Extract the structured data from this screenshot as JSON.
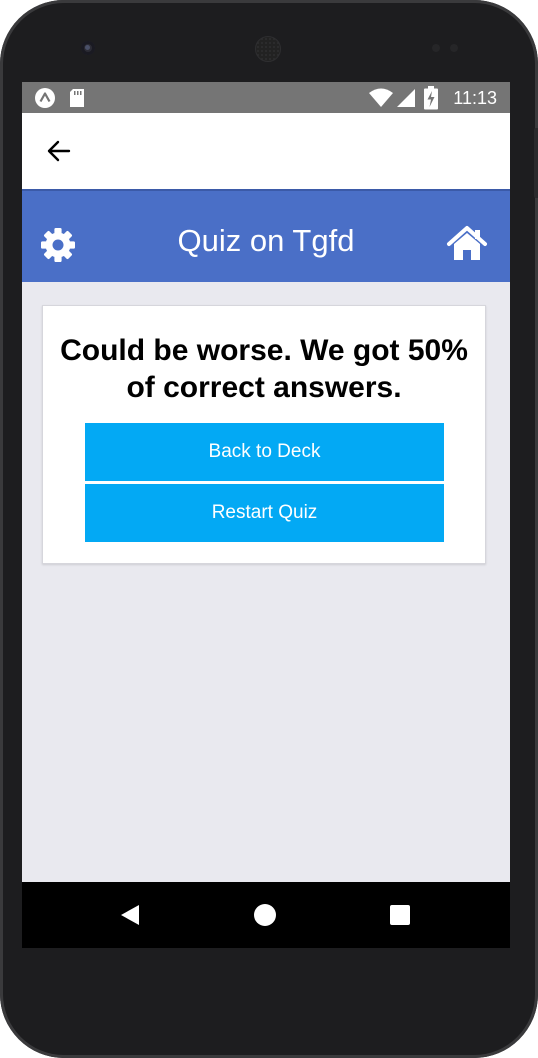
{
  "status_bar": {
    "time": "11:13",
    "left_icons": [
      "expo-icon",
      "sd-card-icon"
    ],
    "right_icons": [
      "wifi-icon",
      "signal-icon",
      "battery-charging-icon"
    ]
  },
  "app_bar": {
    "back_icon": "arrow-left-icon"
  },
  "header": {
    "title": "Quiz on Tgfd",
    "left_icon": "gear-icon",
    "right_icon": "home-icon",
    "background": "#4a6fc7"
  },
  "result_card": {
    "message": "Could be worse. We got 50% of correct answers.",
    "score_percent": 50,
    "buttons": {
      "back_to_deck": "Back to Deck",
      "restart_quiz": "Restart Quiz"
    },
    "button_color": "#03a9f4"
  },
  "nav_bar": {
    "buttons": [
      "back-triangle-icon",
      "home-circle-icon",
      "recents-square-icon"
    ]
  }
}
